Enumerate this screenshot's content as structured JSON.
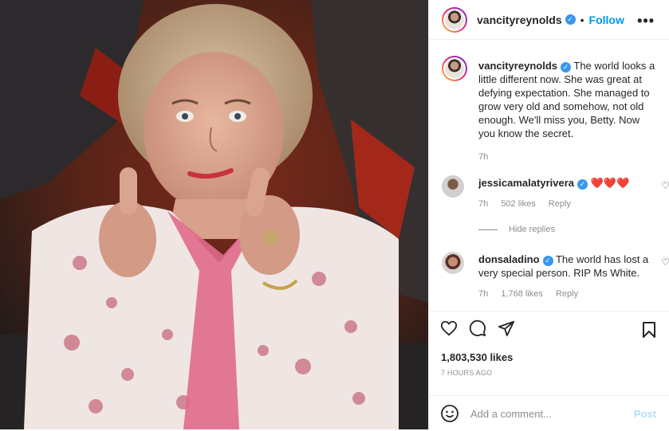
{
  "header": {
    "username": "vancityreynolds",
    "separator": "•",
    "follow_label": "Follow",
    "more_icon": "more-horizontal-icon"
  },
  "caption": {
    "username": "vancityreynolds",
    "text": "The world looks a little different now. She was great at defying expectation. She managed to grow very old and somehow, not old enough. We'll miss you, Betty. Now you know the secret.",
    "time": "7h"
  },
  "comments": [
    {
      "username": "jessicamalatyrivera",
      "text": "❤️❤️❤️",
      "time": "7h",
      "likes": "502 likes",
      "reply_label": "Reply"
    },
    {
      "username": "donsaladino",
      "text": "The world has lost a very special person. RIP Ms White.",
      "time": "7h",
      "likes": "1,768 likes",
      "reply_label": "Reply"
    }
  ],
  "hide_replies_label": "Hide replies",
  "actions": {
    "likes": "1,803,530 likes",
    "posted": "7 HOURS AGO",
    "comment_placeholder": "Add a comment...",
    "post_label": "Post"
  },
  "colors": {
    "accent": "#0095f6",
    "verified": "#3897f0",
    "muted": "#8e8e8e",
    "heart_red": "#ed1c3f"
  }
}
